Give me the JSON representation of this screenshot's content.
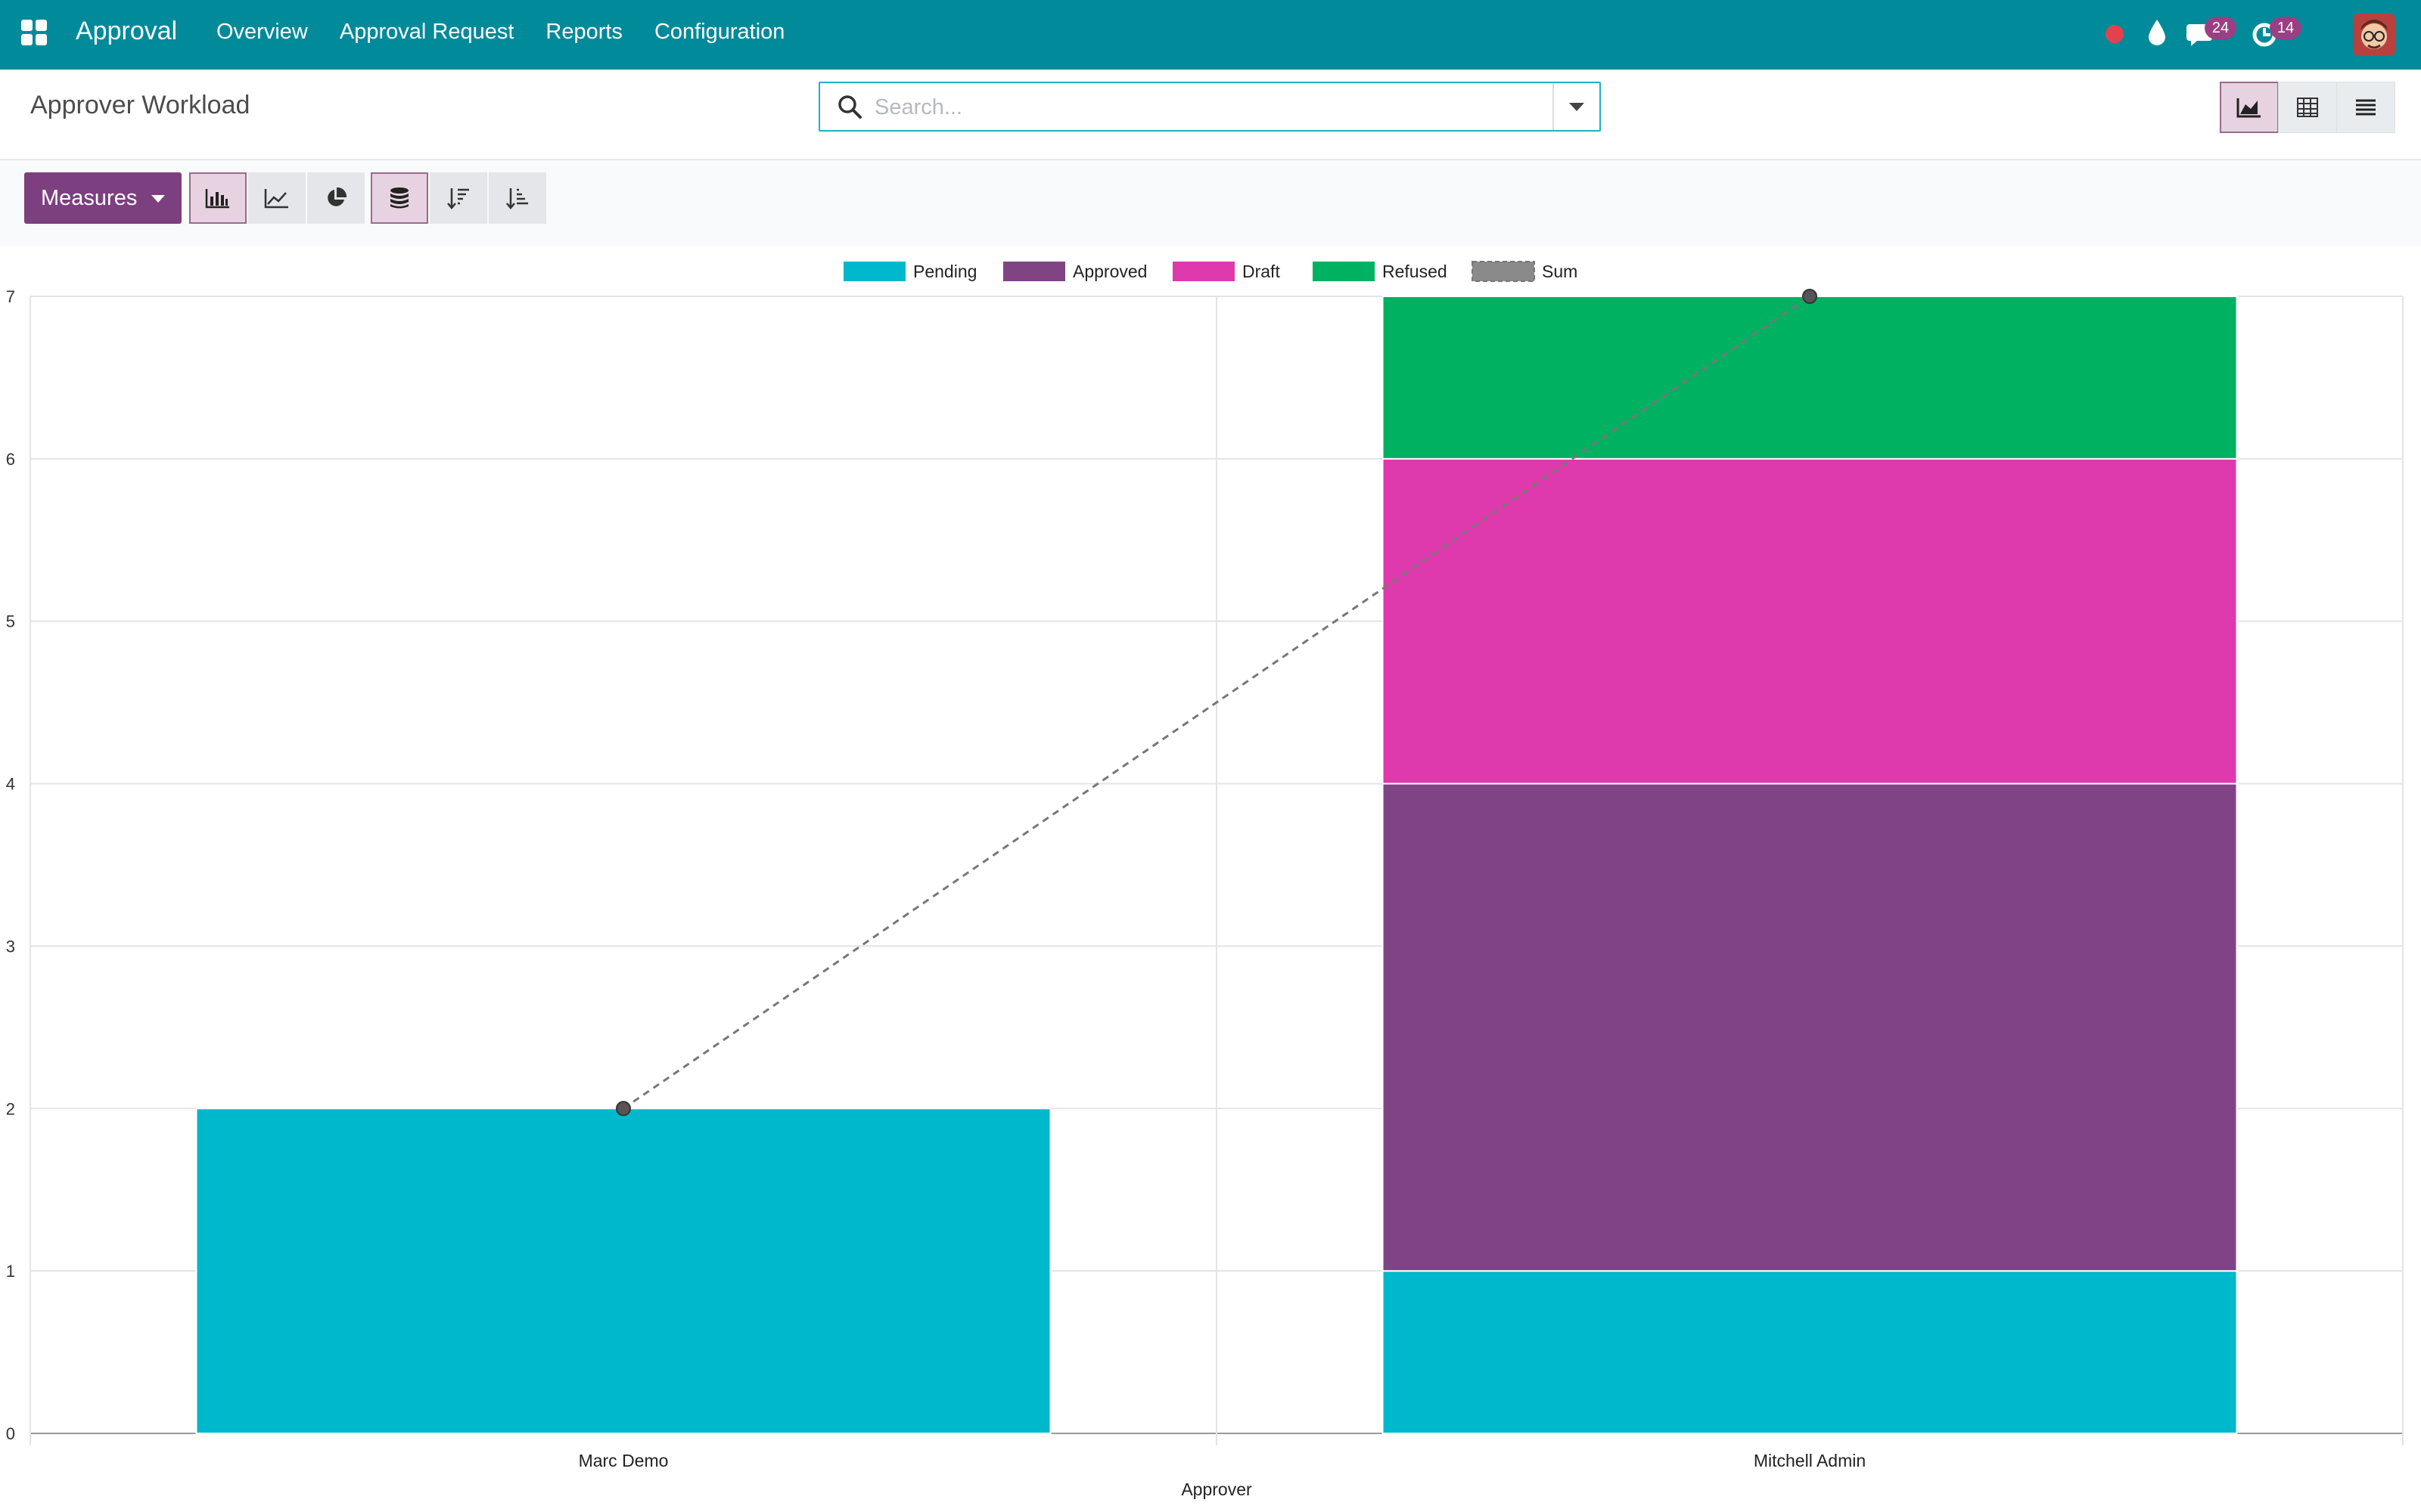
{
  "navbar": {
    "app_name": "Approval",
    "menu": [
      "Overview",
      "Approval Request",
      "Reports",
      "Configuration"
    ],
    "messages_count": "24",
    "activities_count": "14"
  },
  "control_panel": {
    "title": "Approver Workload",
    "search_placeholder": "Search..."
  },
  "toolbar": {
    "measures_label": "Measures"
  },
  "colors": {
    "navbar": "#008a9a",
    "primary": "#7c3f7f",
    "pending": "#00b8cc",
    "approved": "#804484",
    "draft": "#de3aae",
    "refused": "#00b162",
    "sum": "#777777"
  },
  "chart_data": {
    "type": "bar",
    "stacked": true,
    "categories": [
      "Marc Demo",
      "Mitchell Admin"
    ],
    "xlabel": "Approver",
    "ylabel": "",
    "ylim": [
      0,
      7
    ],
    "yticks": [
      0,
      1,
      2,
      3,
      4,
      5,
      6,
      7
    ],
    "grid": true,
    "legend_position": "top",
    "series": [
      {
        "name": "Pending",
        "values": [
          2,
          1
        ],
        "color": "#00b8cc"
      },
      {
        "name": "Approved",
        "values": [
          0,
          3
        ],
        "color": "#804484"
      },
      {
        "name": "Draft",
        "values": [
          0,
          2
        ],
        "color": "#de3aae"
      },
      {
        "name": "Refused",
        "values": [
          0,
          1
        ],
        "color": "#00b162"
      }
    ],
    "sum_line": {
      "name": "Sum",
      "values": [
        2,
        7
      ],
      "style": "dashed",
      "color": "#777777"
    }
  }
}
